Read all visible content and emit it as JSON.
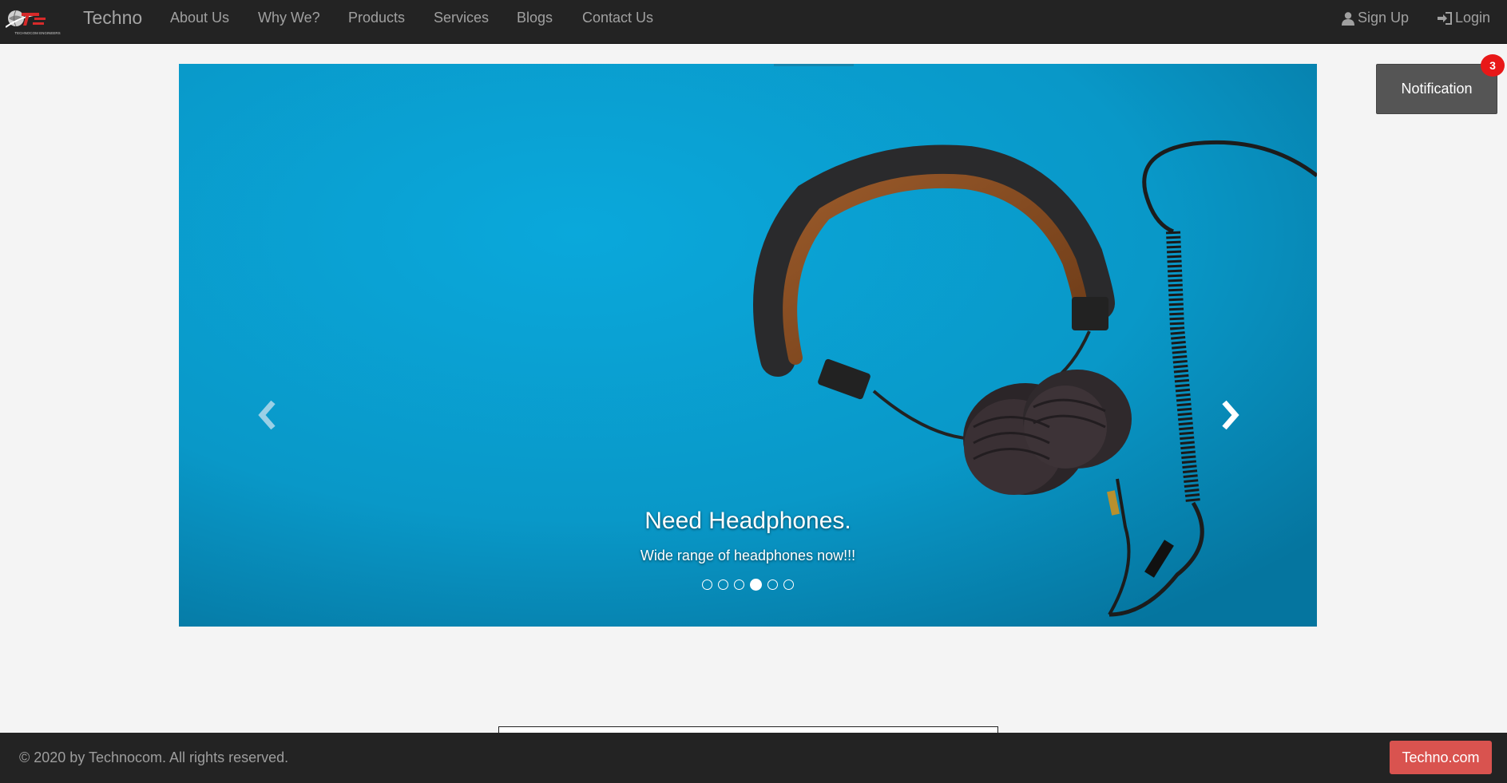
{
  "navbar": {
    "brand": "Techno",
    "logo_text": "TECHNOCOM ENGINEERS",
    "links": [
      "About Us",
      "Why We?",
      "Products",
      "Services",
      "Blogs",
      "Contact Us"
    ],
    "signup_label": "Sign Up",
    "login_label": "Login"
  },
  "carousel": {
    "caption_title": "Need Headphones.",
    "caption_subtitle": "Wide range of headphones now!!!",
    "slide_count": 6,
    "active_index": 3,
    "background_color": "#0aa0d3"
  },
  "notification": {
    "label": "Notification",
    "badge_count": "3"
  },
  "footer": {
    "copyright": "© 2020 by Technocom. All rights reserved.",
    "site_button": "Techno.com"
  },
  "colors": {
    "navbar_bg": "#232323",
    "page_bg": "#f4f4f4",
    "accent_red": "#d9534f",
    "badge_red": "#e81818",
    "notification_bg": "#555555"
  }
}
